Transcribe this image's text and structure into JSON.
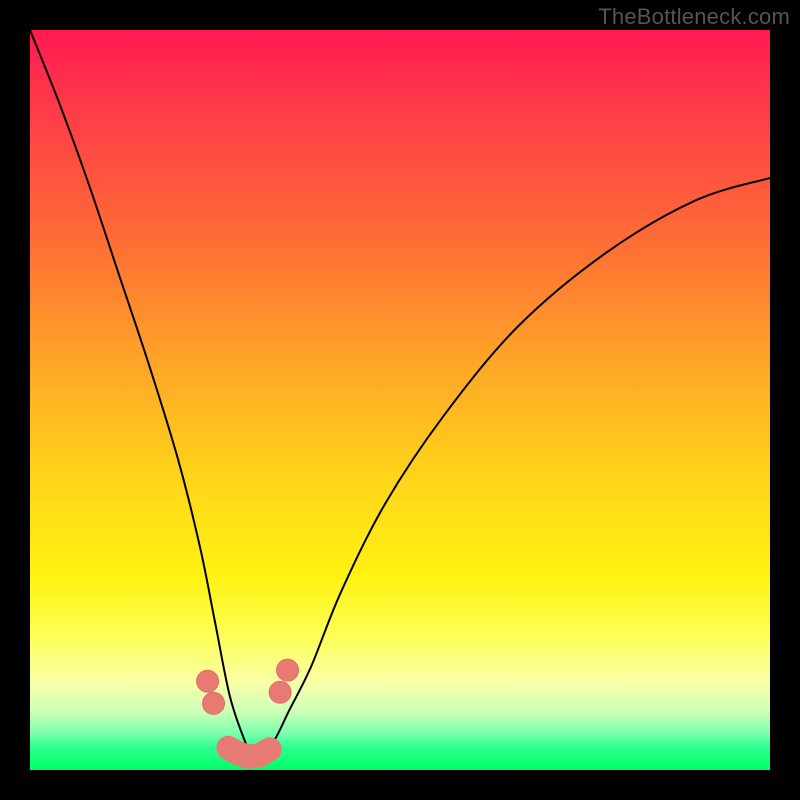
{
  "watermark": "TheBottleneck.com",
  "chart_data": {
    "type": "line",
    "title": "",
    "xlabel": "",
    "ylabel": "",
    "xlim": [
      0,
      100
    ],
    "ylim": [
      0,
      100
    ],
    "note": "Bottleneck/performance curve. No axis ticks or numeric labels visible. Y increases upward; lower y (green zone) = better match. Curve dips to a minimum near x≈30 then rises.",
    "series": [
      {
        "name": "bottleneck-curve",
        "x": [
          0,
          4,
          8,
          12,
          16,
          20,
          23,
          25,
          27,
          29,
          30,
          31,
          33,
          35,
          38,
          42,
          48,
          56,
          66,
          78,
          90,
          100
        ],
        "y": [
          100,
          90,
          79,
          67,
          55,
          42,
          30,
          20,
          10,
          4,
          2,
          2,
          4,
          8,
          14,
          24,
          36,
          48,
          60,
          70,
          77,
          80
        ]
      }
    ],
    "markers": [
      {
        "x": 24.0,
        "y": 12.0
      },
      {
        "x": 24.8,
        "y": 9.0
      },
      {
        "x": 33.8,
        "y": 10.5
      },
      {
        "x": 34.8,
        "y": 13.5
      },
      {
        "x": 26.8,
        "y": 3.0
      },
      {
        "x": 28.2,
        "y": 2.2
      },
      {
        "x": 29.6,
        "y": 1.8
      },
      {
        "x": 31.0,
        "y": 2.0
      },
      {
        "x": 32.4,
        "y": 2.8
      }
    ],
    "gradient_colors": {
      "top": "#ff1a52",
      "mid": "#fff312",
      "bottom": "#00ff66"
    }
  }
}
